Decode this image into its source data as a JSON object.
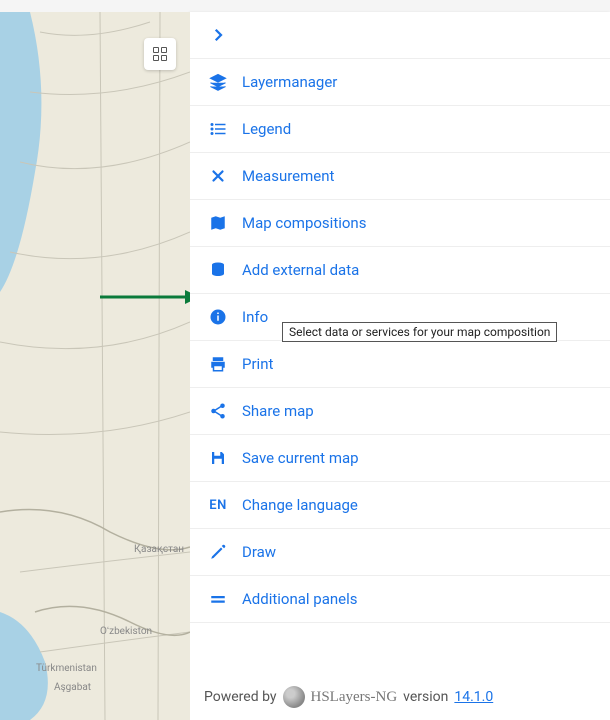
{
  "sidebar": {
    "items": [
      {
        "label": ""
      },
      {
        "label": "Layermanager"
      },
      {
        "label": "Legend"
      },
      {
        "label": "Measurement"
      },
      {
        "label": "Map compositions"
      },
      {
        "label": "Add external data"
      },
      {
        "label": "Info"
      },
      {
        "label": "Print"
      },
      {
        "label": "Share map"
      },
      {
        "label": "Save current map"
      },
      {
        "label": "Change language",
        "lang": "EN"
      },
      {
        "label": "Draw"
      },
      {
        "label": "Additional panels"
      }
    ]
  },
  "tooltip": "Select data or services for your map composition",
  "footer": {
    "powered_by": "Powered by",
    "brand": "HSLayers-NG",
    "version_label": "version",
    "version": "14.1.0"
  },
  "map": {
    "labels": {
      "kazakhstan": "Қазақстан",
      "uzbekistan": "Oʻzbekiston",
      "turkmenistan": "Türkmenistan",
      "ashgabat": "Aşgabat"
    }
  }
}
